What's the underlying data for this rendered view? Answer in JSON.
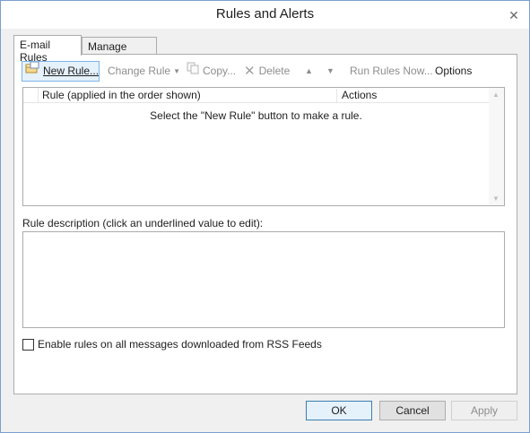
{
  "window": {
    "title": "Rules and Alerts",
    "close_glyph": "✕"
  },
  "tabs": [
    {
      "label": "E-mail Rules",
      "active": true
    },
    {
      "label": "Manage Alerts",
      "active": false
    }
  ],
  "toolbar": {
    "new_rule": "New Rule...",
    "change_rule": "Change Rule",
    "copy": "Copy...",
    "delete": "Delete",
    "move_up_icon": "triangle-up",
    "move_down_icon": "triangle-down",
    "run_rules": "Run Rules Now...",
    "options": "Options"
  },
  "rules_list": {
    "columns": [
      "Rule (applied in the order shown)",
      "Actions"
    ],
    "empty_message": "Select the \"New Rule\" button to make a rule."
  },
  "description": {
    "label": "Rule description (click an underlined value to edit):"
  },
  "rss": {
    "label": "Enable rules on all messages downloaded from RSS Feeds",
    "checked": false
  },
  "buttons": {
    "ok": "OK",
    "cancel": "Cancel",
    "apply": "Apply"
  },
  "colors": {
    "accent": "#3c7fb1",
    "hover": "#e5f1fb",
    "disabled_text": "#8d8d8d"
  }
}
